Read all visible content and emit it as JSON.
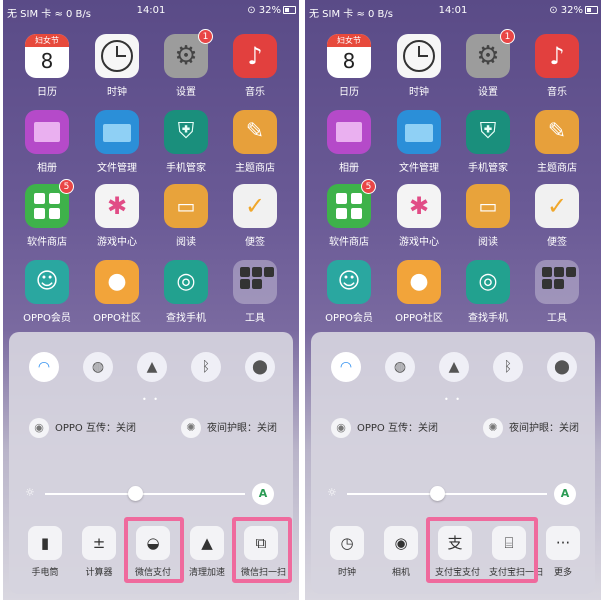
{
  "status": {
    "left": "无 SIM 卡 ≈ 0 B/s",
    "time": "14:01",
    "battery": "⊙ 32%"
  },
  "calendar_header": "妇女节",
  "calendar_day": "8",
  "apps": [
    "日历",
    "时钟",
    "设置",
    "音乐",
    "相册",
    "文件管理",
    "手机管家",
    "主题商店",
    "软件商店",
    "游戏中心",
    "阅读",
    "便签",
    "OPPO会员",
    "OPPO社区",
    "查找手机",
    "工具"
  ],
  "badges": {
    "settings": "1",
    "store": "5"
  },
  "info": {
    "screencast": "OPPO 互传：关闭",
    "night": "夜间护眼：关闭"
  },
  "brightness": {
    "level": 0.45,
    "auto_label": "A"
  },
  "left_shortcuts": [
    "手电筒",
    "计算器",
    "微信支付",
    "清理加速",
    "微信扫一扫"
  ],
  "right_shortcuts": [
    "时钟",
    "相机",
    "支付宝支付",
    "支付宝扫一扫",
    "更多"
  ],
  "colors": {
    "highlight": "#ef6a9d",
    "wifi_on": "#2d8ef0"
  }
}
